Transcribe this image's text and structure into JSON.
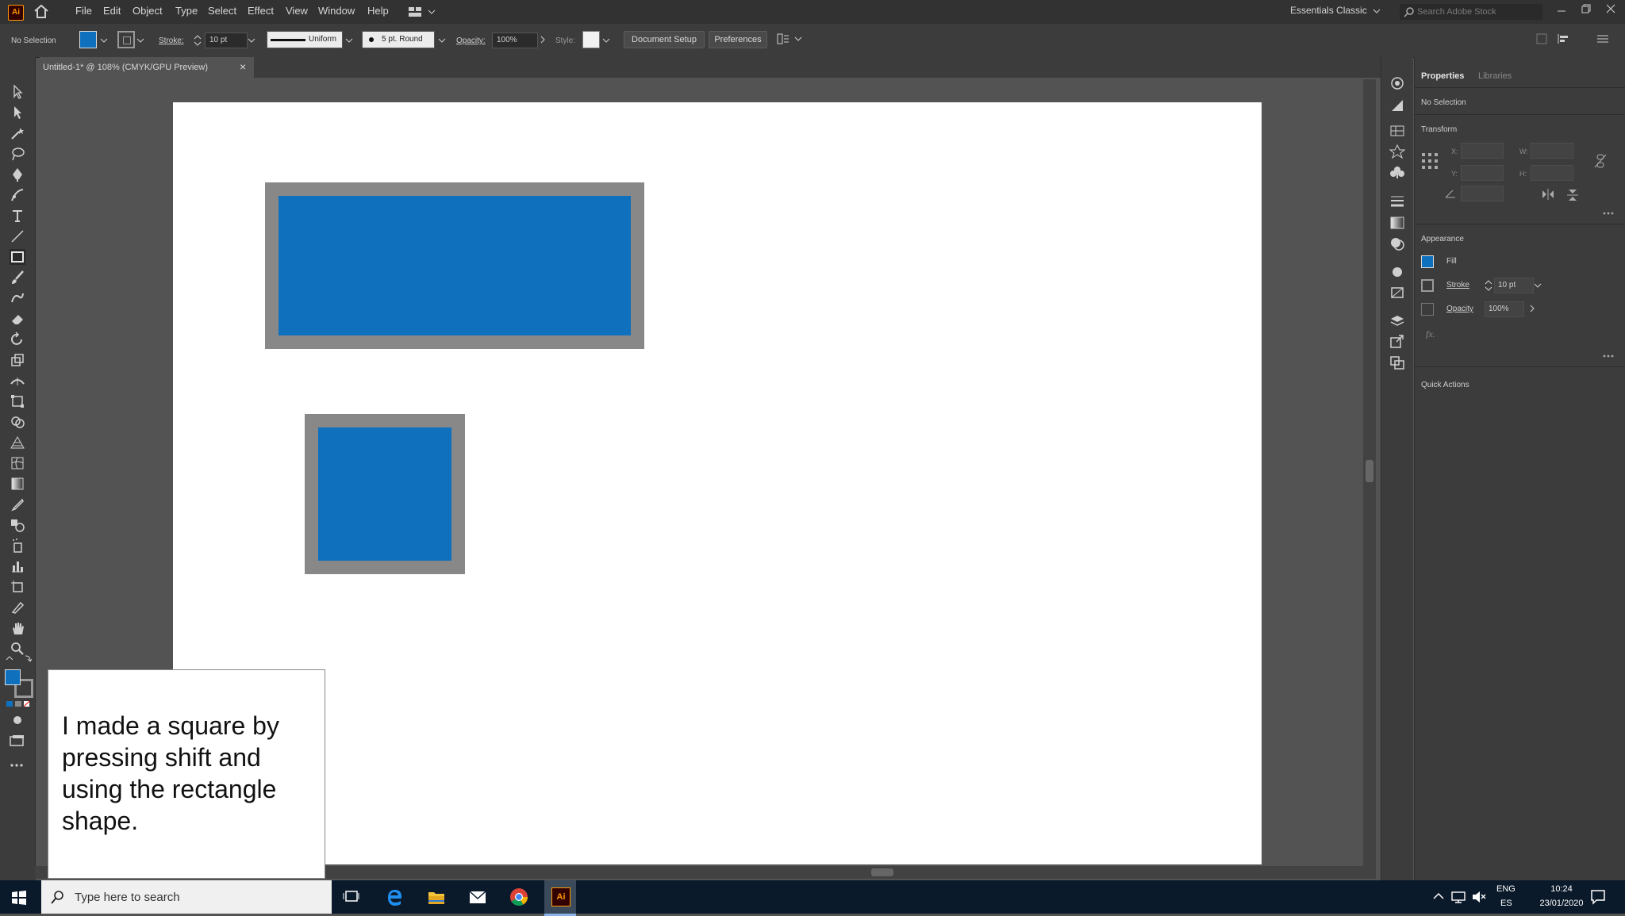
{
  "menubar": {
    "app_logo": "Ai",
    "items": [
      "File",
      "Edit",
      "Object",
      "Type",
      "Select",
      "Effect",
      "View",
      "Window",
      "Help"
    ],
    "workspace": "Essentials Classic",
    "search_placeholder": "Search Adobe Stock"
  },
  "controlbar": {
    "selection": "No Selection",
    "stroke_label": "Stroke:",
    "stroke_value": "10 pt",
    "uniform_label": "Uniform",
    "brush_label": "5 pt. Round",
    "opacity_label": "Opacity:",
    "opacity_value": "100%",
    "style_label": "Style:",
    "document_setup": "Document Setup",
    "preferences": "Preferences"
  },
  "document_tab": {
    "title": "Untitled-1* @ 108% (CMYK/GPU Preview)",
    "close": "×"
  },
  "properties": {
    "tab_properties": "Properties",
    "tab_libraries": "Libraries",
    "selection": "No Selection",
    "transform": "Transform",
    "x_label": "X:",
    "y_label": "Y:",
    "w_label": "W:",
    "h_label": "H:",
    "appearance": "Appearance",
    "fill_label": "Fill",
    "stroke_label": "Stroke",
    "stroke_value": "10 pt",
    "opacity_label": "Opacity",
    "opacity_value": "100%",
    "fx_label": "fx.",
    "quick_actions": "Quick Actions"
  },
  "canvas": {
    "fill_color": "#0f70bd",
    "stroke_color": "#888888"
  },
  "caption": {
    "text": "I made a square by pressing shift and using the rectangle shape."
  },
  "taskbar": {
    "search_placeholder": "Type here to search",
    "lang_top": "ENG",
    "lang_bottom": "ES",
    "time": "10:24",
    "date": "23/01/2020"
  }
}
